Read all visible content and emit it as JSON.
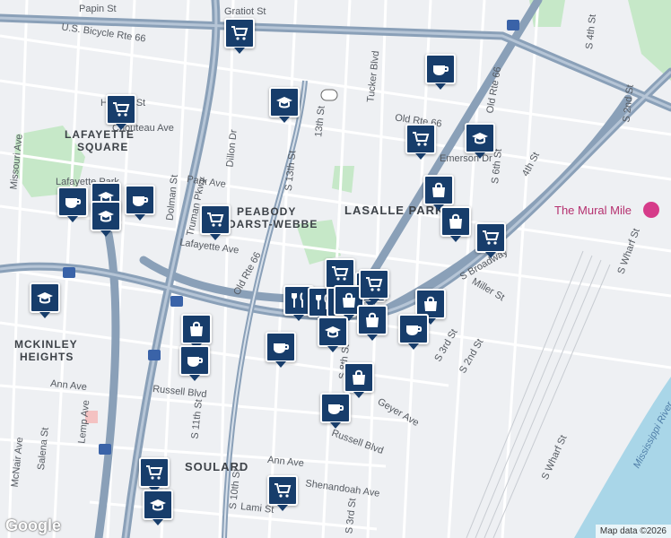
{
  "map": {
    "attribution": "Map data ©2026",
    "logo": "Google",
    "colors": {
      "water": "#a9d6e8",
      "park": "#c6e8c8",
      "highway": "#8aa0b8",
      "road": "#ffffff",
      "pin": "#173d6b",
      "poi": "#b5306f"
    }
  },
  "labels": [
    {
      "text": "Papin St",
      "cls": ""
    },
    {
      "text": "Gratiot St",
      "cls": ""
    },
    {
      "text": "U.S. Bicycle Rte 66",
      "cls": ""
    },
    {
      "text": "Tucker Blvd",
      "cls": ""
    },
    {
      "text": "S 4th St",
      "cls": ""
    },
    {
      "text": "Hickory St",
      "cls": ""
    },
    {
      "text": "Chouteau Ave",
      "cls": ""
    },
    {
      "text": "LAFAYETTE",
      "cls": "hood"
    },
    {
      "text": "SQUARE",
      "cls": "hood"
    },
    {
      "text": "Missouri Ave",
      "cls": ""
    },
    {
      "text": "Dillon Dr",
      "cls": ""
    },
    {
      "text": "Lafayette Park",
      "cls": ""
    },
    {
      "text": "Park Ave",
      "cls": ""
    },
    {
      "text": "S 13th St",
      "cls": ""
    },
    {
      "text": "13th St",
      "cls": ""
    },
    {
      "text": "Old Rte 66",
      "cls": ""
    },
    {
      "text": "LASALLE PARK",
      "cls": "big"
    },
    {
      "text": "PEABODY",
      "cls": "hood"
    },
    {
      "text": "DARST-WEBBE",
      "cls": "hood"
    },
    {
      "text": "Truman Pkwy",
      "cls": ""
    },
    {
      "text": "Dolman St",
      "cls": ""
    },
    {
      "text": "Lafayette Ave",
      "cls": ""
    },
    {
      "text": "Old Rte 66",
      "cls": ""
    },
    {
      "text": "The Mural Mile",
      "cls": "poi"
    },
    {
      "text": "S Broadway",
      "cls": ""
    },
    {
      "text": "Miller St",
      "cls": ""
    },
    {
      "text": "S 6th St",
      "cls": ""
    },
    {
      "text": "S 2nd St",
      "cls": ""
    },
    {
      "text": "MCKINLEY",
      "cls": "hood"
    },
    {
      "text": "HEIGHTS",
      "cls": "hood"
    },
    {
      "text": "Ann Ave",
      "cls": ""
    },
    {
      "text": "Russell Blvd",
      "cls": ""
    },
    {
      "text": "Lemp Ave",
      "cls": ""
    },
    {
      "text": "Salena St",
      "cls": ""
    },
    {
      "text": "McNair Ave",
      "cls": ""
    },
    {
      "text": "S 11th St",
      "cls": ""
    },
    {
      "text": "SOULARD",
      "cls": "big"
    },
    {
      "text": "Ann Ave",
      "cls": ""
    },
    {
      "text": "Russell Blvd",
      "cls": ""
    },
    {
      "text": "Shenandoah Ave",
      "cls": ""
    },
    {
      "text": "Lami St",
      "cls": ""
    },
    {
      "text": "S 10th St",
      "cls": ""
    },
    {
      "text": "S 3rd St",
      "cls": ""
    },
    {
      "text": "Geyer Ave",
      "cls": ""
    },
    {
      "text": "S 8th St",
      "cls": ""
    },
    {
      "text": "S 3rd St",
      "cls": ""
    },
    {
      "text": "S 2nd St",
      "cls": ""
    },
    {
      "text": "S Wharf St",
      "cls": ""
    },
    {
      "text": "S Wharf St",
      "cls": ""
    },
    {
      "text": "Mississippi River",
      "cls": "water"
    },
    {
      "text": "Old Rte 66",
      "cls": ""
    },
    {
      "text": "4th St",
      "cls": ""
    },
    {
      "text": "Emerson Dr",
      "cls": ""
    }
  ],
  "pins": [
    {
      "type": "cart"
    },
    {
      "type": "cart"
    },
    {
      "type": "school"
    },
    {
      "type": "coffee"
    },
    {
      "type": "cart"
    },
    {
      "type": "school"
    },
    {
      "type": "coffee"
    },
    {
      "type": "school"
    },
    {
      "type": "coffee"
    },
    {
      "type": "school"
    },
    {
      "type": "cart"
    },
    {
      "type": "bag"
    },
    {
      "type": "bag"
    },
    {
      "type": "cart"
    },
    {
      "type": "school"
    },
    {
      "type": "dining"
    },
    {
      "type": "dining"
    },
    {
      "type": "cart"
    },
    {
      "type": "dining"
    },
    {
      "type": "cart"
    },
    {
      "type": "bag"
    },
    {
      "type": "bag"
    },
    {
      "type": "bag"
    },
    {
      "type": "coffee"
    },
    {
      "type": "school"
    },
    {
      "type": "bag"
    },
    {
      "type": "coffee"
    },
    {
      "type": "coffee"
    },
    {
      "type": "bag"
    },
    {
      "type": "coffee"
    },
    {
      "type": "cart"
    },
    {
      "type": "school"
    },
    {
      "type": "cart"
    },
    {
      "type": "cart"
    }
  ]
}
